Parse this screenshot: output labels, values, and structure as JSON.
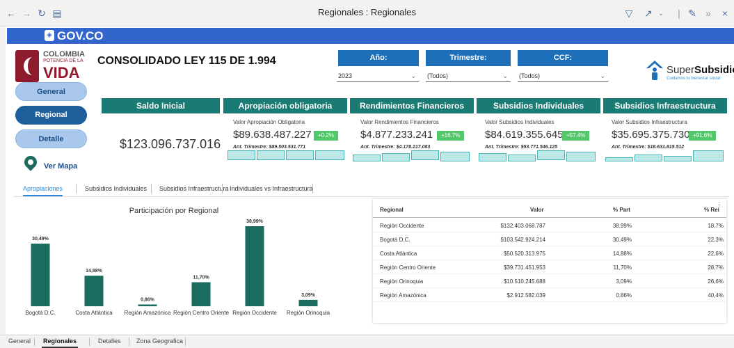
{
  "window": {
    "title": "Regionales : Regionales"
  },
  "header": {
    "gov_label": "GOV.CO",
    "page_title": "CONSOLIDADO LEY 115 DE 1.994"
  },
  "logo_left": {
    "line1": "COLOMBIA",
    "line2": "POTENCIA DE LA",
    "line3": "VIDA"
  },
  "logo_right": {
    "name_prefix": "Super",
    "name_bold": "Subsidio",
    "tagline": "Cuidamos tu bienestar social"
  },
  "filters": [
    {
      "label": "Año:",
      "value": "2023"
    },
    {
      "label": "Trimestre:",
      "value": "(Todos)"
    },
    {
      "label": "CCF:",
      "value": "(Todos)"
    }
  ],
  "nav": {
    "general": "General",
    "regional": "Regional",
    "detalle": "Detalle",
    "map": "Ver Mapa"
  },
  "kpis": {
    "saldo_inicial": {
      "title": "Saldo Inicial",
      "value": "$123.096.737.016"
    },
    "cards": [
      {
        "title": "Apropiación obligatoria",
        "label": "Valor Apropiación Obligatoria",
        "value": "$89.638.487.227",
        "badge": "+0.2%",
        "prev": "Ant. Trimestre: $89.503.531.771"
      },
      {
        "title": "Rendimientos Financieros",
        "label": "Valor Rendimientos Financieros",
        "value": "$4.877.233.241",
        "badge": "+16.7%",
        "prev": "Ant. Trimestre: $4.178.217.083"
      },
      {
        "title": "Subsidios Individuales",
        "label": "Valor Subsidios Individuales",
        "value": "$84.619.355.645",
        "badge": "+57.4%",
        "prev": "Ant. Trimestre: $53.771.546.125"
      },
      {
        "title": "Subsidios Infraestructura",
        "label": "Valor Subsidios Infraestructura",
        "value": "$35.695.375.730",
        "badge": "+91.6%",
        "prev": "Ant. Trimestre: $18.631.815.512"
      }
    ]
  },
  "tabs": [
    "Apropiaciones",
    "Subsidios Individuales",
    "Subsidios Infraestructura",
    "Individuales vs Infraestructura"
  ],
  "chart_data": {
    "type": "bar",
    "title": "Participación por Regional",
    "categories": [
      "Bogotá D.C.",
      "Costa Atlántica",
      "Región Amazónica",
      "Región Centro Oriente",
      "Región Occidente",
      "Región Orinoquia"
    ],
    "values": [
      30.49,
      14.88,
      0.86,
      11.7,
      38.99,
      3.09
    ],
    "labels": [
      "30,49%",
      "14,88%",
      "0,86%",
      "11,70%",
      "38,99%",
      "3,09%"
    ],
    "ylim": [
      0,
      40
    ],
    "color": "#1b6b5e",
    "grid": false
  },
  "table": {
    "headers": [
      "Regional",
      "Valor",
      "% Part",
      "% Rei"
    ],
    "rows": [
      [
        "Región Occidente",
        "$132.403.068.787",
        "38,99%",
        "18,7%"
      ],
      [
        "Bogotá D.C.",
        "$103.542.924.214",
        "30,49%",
        "22,3%"
      ],
      [
        "Costa Atlántica",
        "$50.520.313.975",
        "14,88%",
        "22,6%"
      ],
      [
        "Región Centro Oriente",
        "$39.731.451.953",
        "11,70%",
        "28,7%"
      ],
      [
        "Región Orinoquia",
        "$10.510.245.688",
        "3,09%",
        "26,6%"
      ],
      [
        "Región Amazónica",
        "$2.912.582.039",
        "0,86%",
        "40,4%"
      ]
    ]
  },
  "bottom_tabs": [
    "General",
    "Regionales",
    "Detalles",
    "Zona Geografica"
  ],
  "colors": {
    "gov_blue": "#3366cc",
    "filter_blue": "#1d6fb8",
    "kpi_teal": "#1a7a74",
    "badge_green": "#52c86a",
    "bar_teal": "#1b6b5e"
  }
}
